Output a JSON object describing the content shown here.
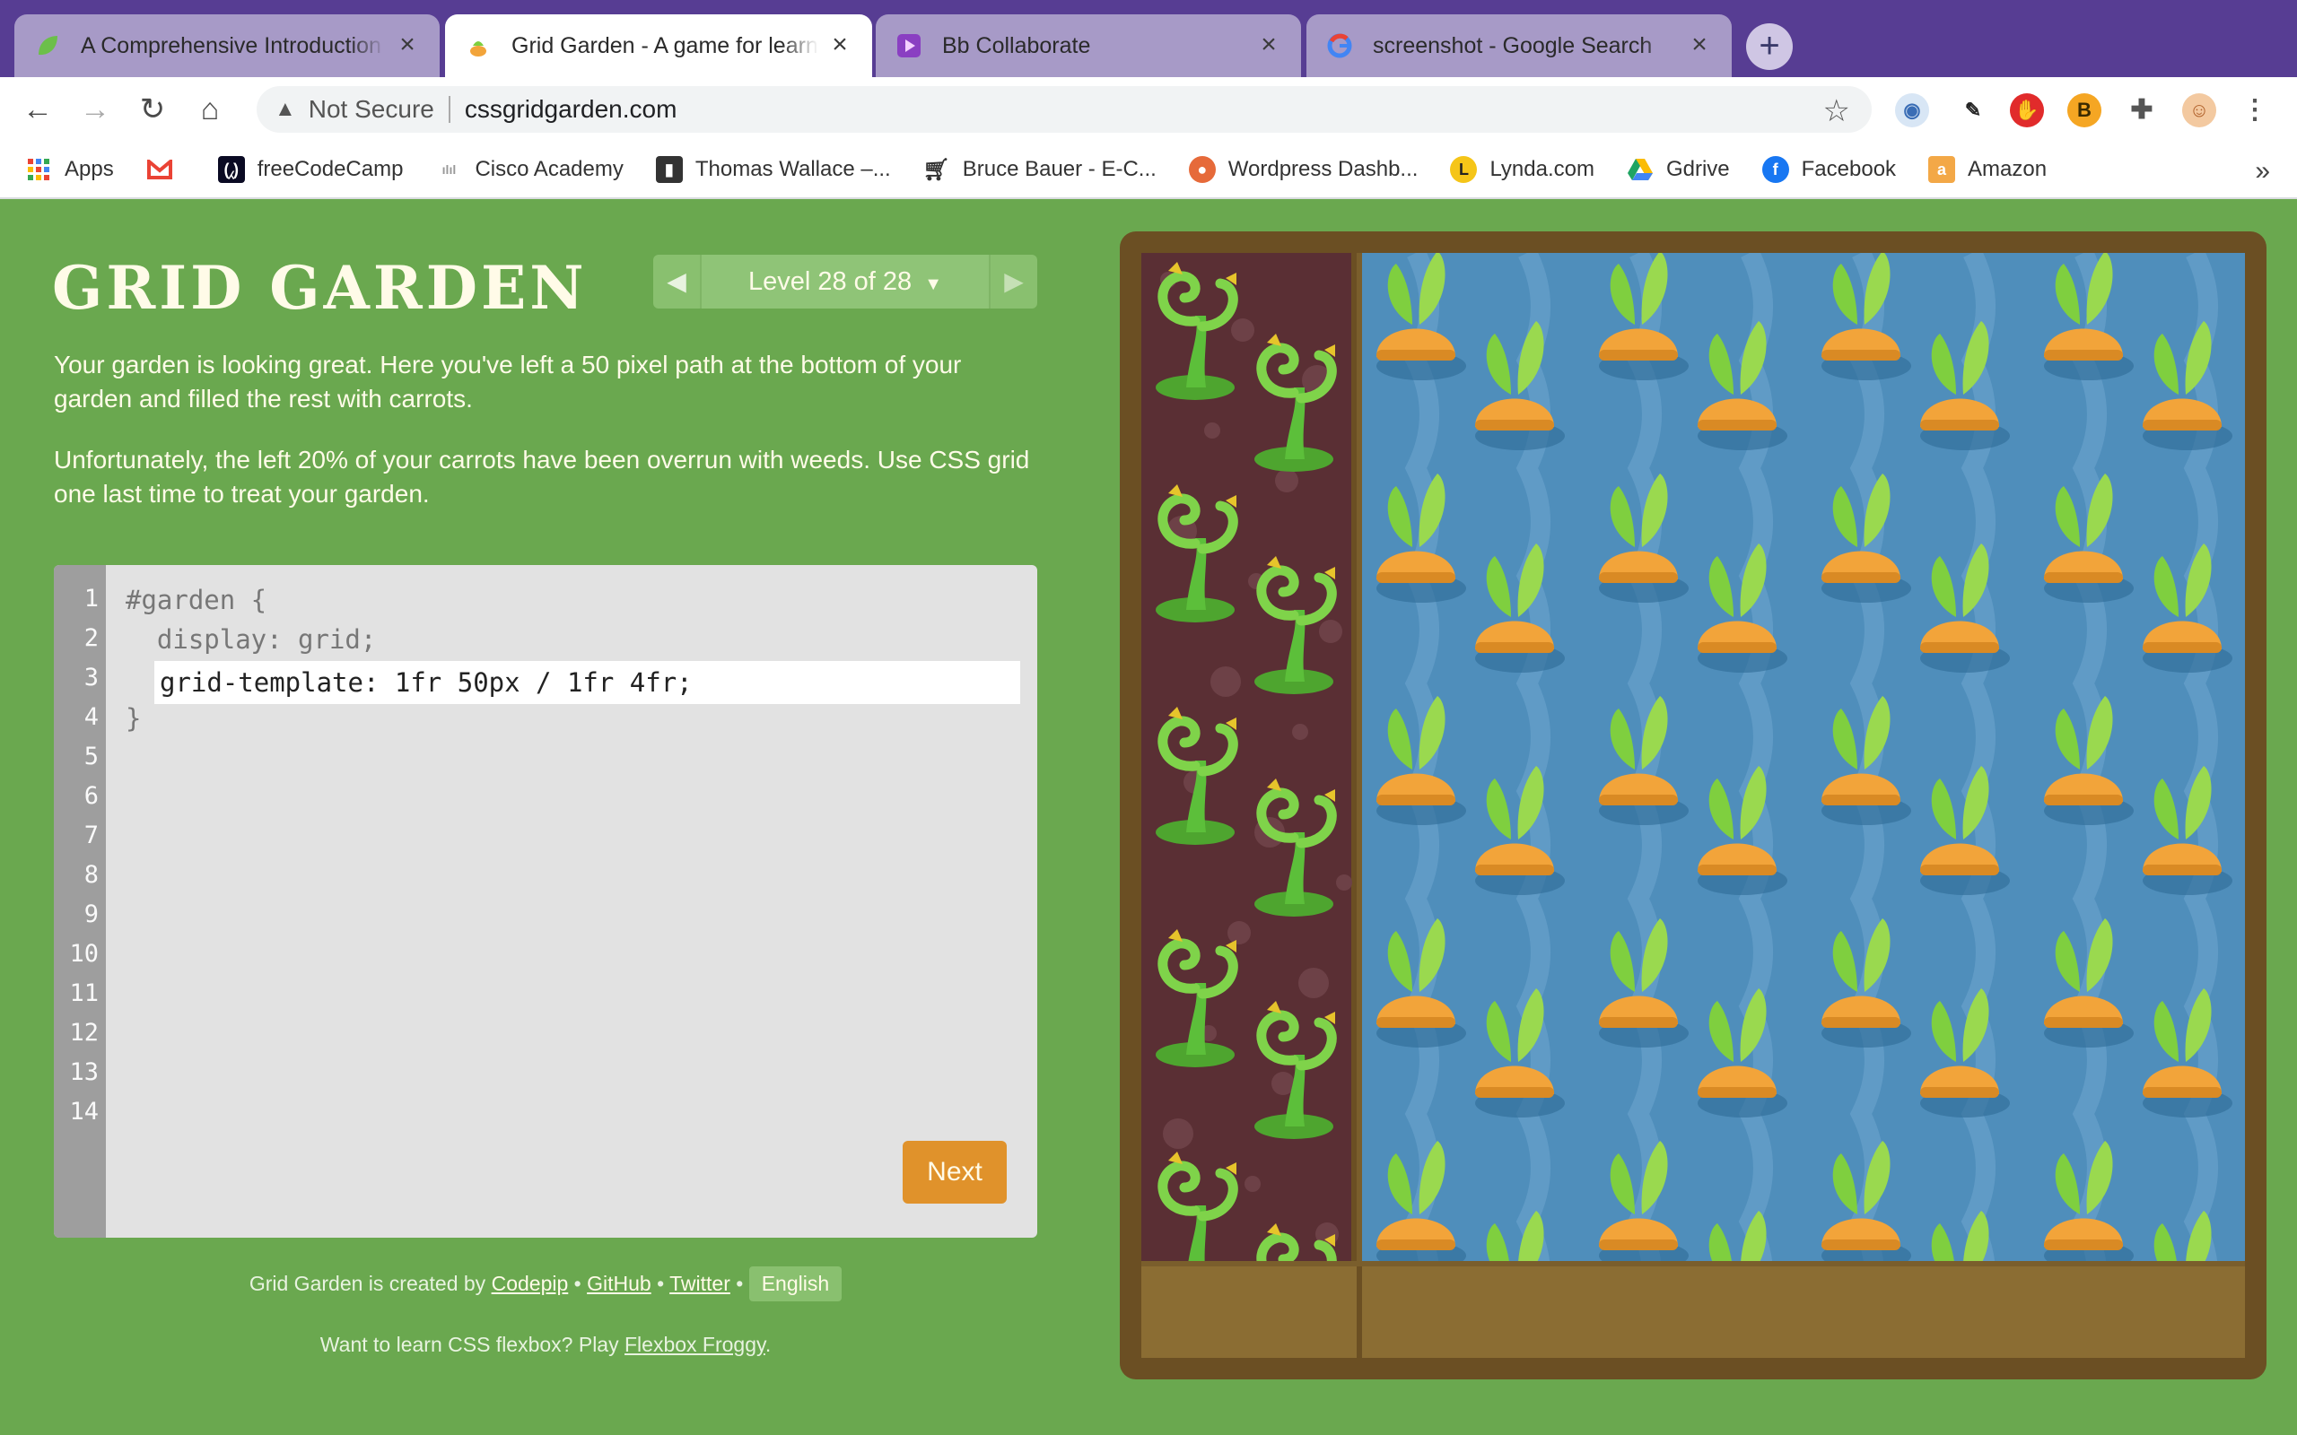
{
  "browser": {
    "tabs": [
      {
        "title": "A Comprehensive Introduction",
        "favicon": "green-leaf-icon",
        "active": false
      },
      {
        "title": "Grid Garden - A game for learn",
        "favicon": "carrot-icon",
        "active": true
      },
      {
        "title": "Bb Collaborate",
        "favicon": "purple-play-icon",
        "active": false
      },
      {
        "title": "screenshot - Google Search",
        "favicon": "google-icon",
        "active": false
      }
    ],
    "security": "Not Secure",
    "url": "cssgridgarden.com",
    "bookmarks": [
      {
        "label": "Apps",
        "icon": "apps-grid-icon",
        "color": "#4285f4"
      },
      {
        "label": "",
        "icon": "gmail-icon",
        "color": "#ea4335"
      },
      {
        "label": "freeCodeCamp",
        "icon": "freecodecamp-icon",
        "color": "#0a0a23"
      },
      {
        "label": "Cisco Academy",
        "icon": "cisco-icon",
        "color": "#999999"
      },
      {
        "label": "Thomas Wallace –...",
        "icon": "thomas-wallace-icon",
        "color": "#333333"
      },
      {
        "label": "Bruce Bauer - E-C...",
        "icon": "shopping-cart-icon",
        "color": "#333333"
      },
      {
        "label": "Wordpress Dashb...",
        "icon": "wordpress-fox-icon",
        "color": "#e66a3a"
      },
      {
        "label": "Lynda.com",
        "icon": "lynda-icon",
        "color": "#222222"
      },
      {
        "label": "Gdrive",
        "icon": "google-drive-icon",
        "color": "#1fa463"
      },
      {
        "label": "Facebook",
        "icon": "facebook-icon",
        "color": "#1877f2"
      },
      {
        "label": "Amazon",
        "icon": "amazon-icon",
        "color": "#f3a847"
      }
    ]
  },
  "game": {
    "title": "GRID GARDEN",
    "level_label": "Level 28 of 28",
    "instructions": [
      "Your garden is looking great. Here you've left a 50 pixel path at the bottom of your garden and filled the rest with carrots.",
      "Unfortunately, the left 20% of your carrots have been overrun with weeds. Use CSS grid one last time to treat your garden."
    ],
    "line_numbers": [
      "1",
      "2",
      "3",
      "4",
      "5",
      "6",
      "7",
      "8",
      "9",
      "10",
      "11",
      "12",
      "13",
      "14"
    ],
    "code": {
      "line1": "#garden {",
      "line2": "  display: grid;",
      "input_value": "grid-template: 1fr 50px / 1fr 4fr;",
      "line4": "}"
    },
    "next_label": "Next",
    "credits": {
      "prefix": "Grid Garden is created by",
      "codepip": "Codepip",
      "github": "GitHub",
      "twitter": "Twitter",
      "language": "English"
    },
    "froggy": {
      "prefix": "Want to learn CSS flexbox? Play",
      "link": "Flexbox Froggy",
      "suffix": "."
    }
  },
  "colors": {
    "page_bg": "#6aa84f",
    "weeds_bg": "#5a2f34",
    "water_bg": "#4f8ebb",
    "carrot": "#f2a43a",
    "leaf": "#7fcf3f",
    "next_button": "#e0922b"
  }
}
